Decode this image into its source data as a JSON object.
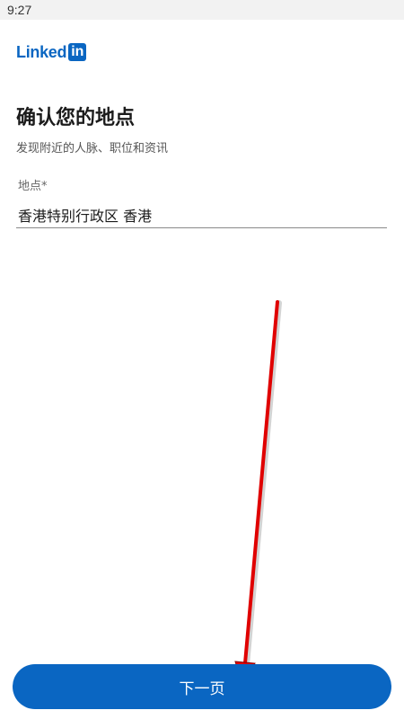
{
  "status_bar": {
    "time": "9:27"
  },
  "logo": {
    "word": "Linked",
    "box_text": "in"
  },
  "page": {
    "title": "确认您的地点",
    "subtitle": "发现附近的人脉、职位和资讯"
  },
  "location_field": {
    "label": "地点*",
    "value": "香港特别行政区 香港"
  },
  "next_button": {
    "label": "下一页"
  },
  "colors": {
    "brand_blue": "#0a66c2",
    "button_blue": "#0a66c2",
    "arrow_red": "#e00000"
  },
  "icons": {
    "annotation": "red-arrow-icon"
  }
}
